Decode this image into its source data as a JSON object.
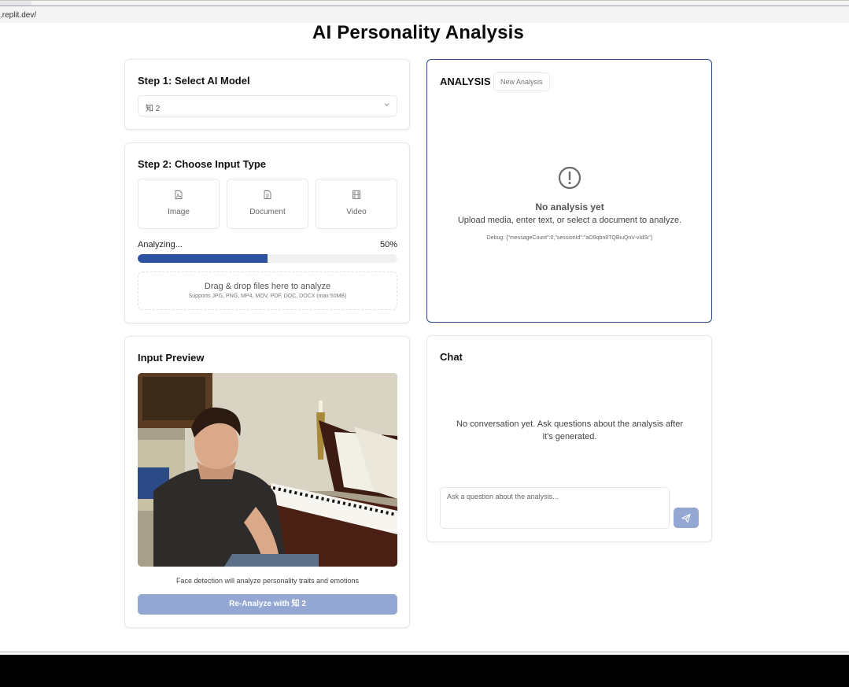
{
  "browser": {
    "url": ".replit.dev/"
  },
  "page": {
    "title": "AI Personality Analysis"
  },
  "step1": {
    "title": "Step 1: Select AI Model",
    "selected_model": "知 2",
    "chevron_icon": "chevron-down-icon"
  },
  "step2": {
    "title": "Step 2: Choose Input Type",
    "types": [
      {
        "label": "Image",
        "icon": "image-file-icon"
      },
      {
        "label": "Document",
        "icon": "document-icon"
      },
      {
        "label": "Video",
        "icon": "film-icon"
      }
    ],
    "progress": {
      "label": "Analyzing...",
      "percent_text": "50%",
      "value": 0.5
    },
    "dropzone": {
      "title": "Drag & drop files here to analyze",
      "subtitle": "Supports JPG, PNG, MP4, MOV, PDF, DOC, DOCX (max 50MB)"
    }
  },
  "preview": {
    "title": "Input Preview",
    "caption": "Face detection will analyze personality traits and emotions",
    "reanalyze_label": "Re-Analyze with 知 2"
  },
  "analysis": {
    "title": "ANALYSIS",
    "new_label": "New Analysis",
    "empty_title": "No analysis yet",
    "empty_text": "Upload media, enter text, or select a document to analyze.",
    "debug": "Debug: {\"messageCount\":0,\"sessionId\":\"aO9qbn8TQBiuQnV-vIdSi\"}"
  },
  "chat": {
    "title": "Chat",
    "empty_text": "No conversation yet. Ask questions about the analysis after it's generated.",
    "placeholder": "Ask a question about the analysis...",
    "send_icon": "send-icon"
  },
  "colors": {
    "accent": "#2c52a0",
    "accent_light": "#93a7d2",
    "border": "#e5e7eb"
  }
}
